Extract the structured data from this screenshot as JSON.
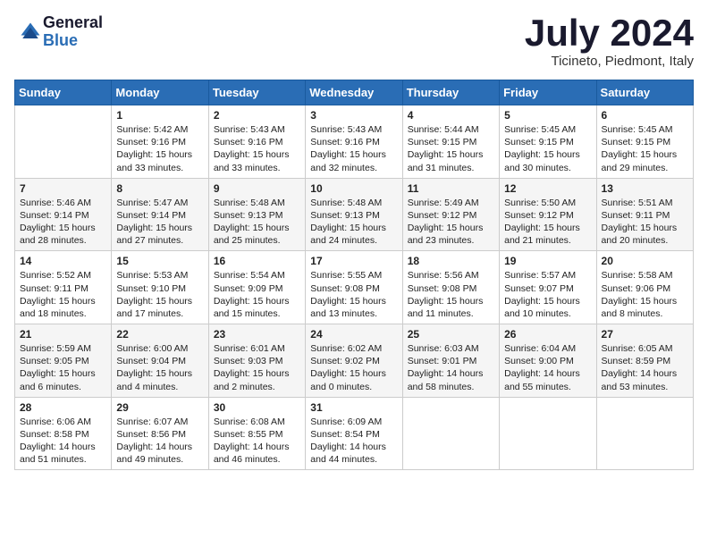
{
  "logo": {
    "general": "General",
    "blue": "Blue"
  },
  "title": "July 2024",
  "subtitle": "Ticineto, Piedmont, Italy",
  "days": [
    "Sunday",
    "Monday",
    "Tuesday",
    "Wednesday",
    "Thursday",
    "Friday",
    "Saturday"
  ],
  "weeks": [
    [
      {
        "day": "",
        "info": ""
      },
      {
        "day": "1",
        "info": "Sunrise: 5:42 AM\nSunset: 9:16 PM\nDaylight: 15 hours\nand 33 minutes."
      },
      {
        "day": "2",
        "info": "Sunrise: 5:43 AM\nSunset: 9:16 PM\nDaylight: 15 hours\nand 33 minutes."
      },
      {
        "day": "3",
        "info": "Sunrise: 5:43 AM\nSunset: 9:16 PM\nDaylight: 15 hours\nand 32 minutes."
      },
      {
        "day": "4",
        "info": "Sunrise: 5:44 AM\nSunset: 9:15 PM\nDaylight: 15 hours\nand 31 minutes."
      },
      {
        "day": "5",
        "info": "Sunrise: 5:45 AM\nSunset: 9:15 PM\nDaylight: 15 hours\nand 30 minutes."
      },
      {
        "day": "6",
        "info": "Sunrise: 5:45 AM\nSunset: 9:15 PM\nDaylight: 15 hours\nand 29 minutes."
      }
    ],
    [
      {
        "day": "7",
        "info": "Sunrise: 5:46 AM\nSunset: 9:14 PM\nDaylight: 15 hours\nand 28 minutes."
      },
      {
        "day": "8",
        "info": "Sunrise: 5:47 AM\nSunset: 9:14 PM\nDaylight: 15 hours\nand 27 minutes."
      },
      {
        "day": "9",
        "info": "Sunrise: 5:48 AM\nSunset: 9:13 PM\nDaylight: 15 hours\nand 25 minutes."
      },
      {
        "day": "10",
        "info": "Sunrise: 5:48 AM\nSunset: 9:13 PM\nDaylight: 15 hours\nand 24 minutes."
      },
      {
        "day": "11",
        "info": "Sunrise: 5:49 AM\nSunset: 9:12 PM\nDaylight: 15 hours\nand 23 minutes."
      },
      {
        "day": "12",
        "info": "Sunrise: 5:50 AM\nSunset: 9:12 PM\nDaylight: 15 hours\nand 21 minutes."
      },
      {
        "day": "13",
        "info": "Sunrise: 5:51 AM\nSunset: 9:11 PM\nDaylight: 15 hours\nand 20 minutes."
      }
    ],
    [
      {
        "day": "14",
        "info": "Sunrise: 5:52 AM\nSunset: 9:11 PM\nDaylight: 15 hours\nand 18 minutes."
      },
      {
        "day": "15",
        "info": "Sunrise: 5:53 AM\nSunset: 9:10 PM\nDaylight: 15 hours\nand 17 minutes."
      },
      {
        "day": "16",
        "info": "Sunrise: 5:54 AM\nSunset: 9:09 PM\nDaylight: 15 hours\nand 15 minutes."
      },
      {
        "day": "17",
        "info": "Sunrise: 5:55 AM\nSunset: 9:08 PM\nDaylight: 15 hours\nand 13 minutes."
      },
      {
        "day": "18",
        "info": "Sunrise: 5:56 AM\nSunset: 9:08 PM\nDaylight: 15 hours\nand 11 minutes."
      },
      {
        "day": "19",
        "info": "Sunrise: 5:57 AM\nSunset: 9:07 PM\nDaylight: 15 hours\nand 10 minutes."
      },
      {
        "day": "20",
        "info": "Sunrise: 5:58 AM\nSunset: 9:06 PM\nDaylight: 15 hours\nand 8 minutes."
      }
    ],
    [
      {
        "day": "21",
        "info": "Sunrise: 5:59 AM\nSunset: 9:05 PM\nDaylight: 15 hours\nand 6 minutes."
      },
      {
        "day": "22",
        "info": "Sunrise: 6:00 AM\nSunset: 9:04 PM\nDaylight: 15 hours\nand 4 minutes."
      },
      {
        "day": "23",
        "info": "Sunrise: 6:01 AM\nSunset: 9:03 PM\nDaylight: 15 hours\nand 2 minutes."
      },
      {
        "day": "24",
        "info": "Sunrise: 6:02 AM\nSunset: 9:02 PM\nDaylight: 15 hours\nand 0 minutes."
      },
      {
        "day": "25",
        "info": "Sunrise: 6:03 AM\nSunset: 9:01 PM\nDaylight: 14 hours\nand 58 minutes."
      },
      {
        "day": "26",
        "info": "Sunrise: 6:04 AM\nSunset: 9:00 PM\nDaylight: 14 hours\nand 55 minutes."
      },
      {
        "day": "27",
        "info": "Sunrise: 6:05 AM\nSunset: 8:59 PM\nDaylight: 14 hours\nand 53 minutes."
      }
    ],
    [
      {
        "day": "28",
        "info": "Sunrise: 6:06 AM\nSunset: 8:58 PM\nDaylight: 14 hours\nand 51 minutes."
      },
      {
        "day": "29",
        "info": "Sunrise: 6:07 AM\nSunset: 8:56 PM\nDaylight: 14 hours\nand 49 minutes."
      },
      {
        "day": "30",
        "info": "Sunrise: 6:08 AM\nSunset: 8:55 PM\nDaylight: 14 hours\nand 46 minutes."
      },
      {
        "day": "31",
        "info": "Sunrise: 6:09 AM\nSunset: 8:54 PM\nDaylight: 14 hours\nand 44 minutes."
      },
      {
        "day": "",
        "info": ""
      },
      {
        "day": "",
        "info": ""
      },
      {
        "day": "",
        "info": ""
      }
    ]
  ]
}
